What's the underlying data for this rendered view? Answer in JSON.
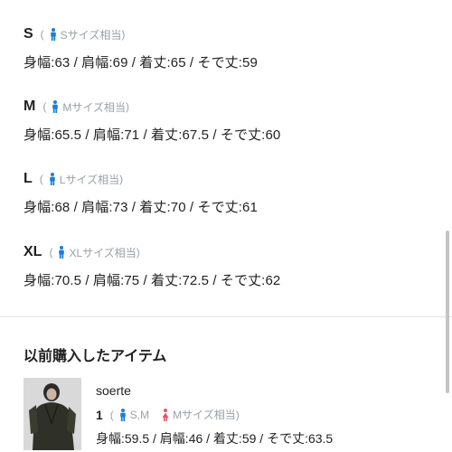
{
  "sizes": [
    {
      "name": "S",
      "note": "Sサイズ相当",
      "measurements": "身幅:63 / 肩幅:69 / 着丈:65 / そで丈:59"
    },
    {
      "name": "M",
      "note": "Mサイズ相当",
      "measurements": "身幅:65.5 / 肩幅:71 / 着丈:67.5 / そで丈:60"
    },
    {
      "name": "L",
      "note": "Lサイズ相当",
      "measurements": "身幅:68 / 肩幅:73 / 着丈:70 / そで丈:61"
    },
    {
      "name": "XL",
      "note": "XLサイズ相当",
      "measurements": "身幅:70.5 / 肩幅:75 / 着丈:72.5 / そで丈:62"
    }
  ],
  "paren_open": "(",
  "paren_close": ")",
  "previous": {
    "title": "以前購入したアイテム",
    "item": {
      "brand": "soerte",
      "fit_count": "1",
      "male_fit": "S,M",
      "female_fit": "Mサイズ相当",
      "measurements": "身幅:59.5 / 肩幅:46 / 着丈:59 / そで丈:63.5"
    }
  },
  "colors": {
    "male_icon": "#1a7fd6",
    "female_icon": "#e0566a",
    "muted": "#9aa0a6"
  },
  "icons": {
    "male": "male-person-icon",
    "female": "female-person-icon"
  }
}
